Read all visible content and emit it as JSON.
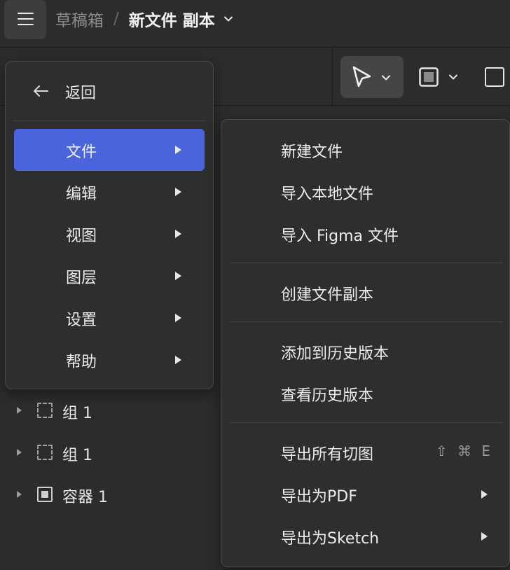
{
  "header": {
    "menu_icon": "hamburger-icon",
    "breadcrumb_parent": "草稿箱",
    "breadcrumb_separator": "/",
    "file_title": "新文件 副本",
    "title_dropdown_icon": "chevron-down-icon"
  },
  "toolbar": {
    "tools": [
      {
        "name": "move-tool",
        "icon": "pointer-icon",
        "has_dropdown": true,
        "active": true
      },
      {
        "name": "frame-tool",
        "icon": "frame-icon",
        "has_dropdown": true
      },
      {
        "name": "rectangle-tool",
        "icon": "rectangle-icon"
      }
    ]
  },
  "main_menu": {
    "back_label": "返回",
    "back_icon": "arrow-left-icon",
    "items": [
      {
        "label": "文件",
        "active": true,
        "has_submenu": true
      },
      {
        "label": "编辑",
        "has_submenu": true
      },
      {
        "label": "视图",
        "has_submenu": true
      },
      {
        "label": "图层",
        "has_submenu": true
      },
      {
        "label": "设置",
        "has_submenu": true
      },
      {
        "label": "帮助",
        "has_submenu": true
      }
    ]
  },
  "file_submenu": {
    "groups": [
      [
        {
          "label": "新建文件"
        },
        {
          "label": "导入本地文件"
        },
        {
          "label": "导入 Figma 文件"
        }
      ],
      [
        {
          "label": "创建文件副本"
        }
      ],
      [
        {
          "label": "添加到历史版本"
        },
        {
          "label": "查看历史版本"
        }
      ],
      [
        {
          "label": "导出所有切图",
          "shortcut": "⇧ ⌘ E"
        },
        {
          "label": "导出为PDF",
          "has_submenu": true
        },
        {
          "label": "导出为Sketch",
          "has_submenu": true
        }
      ]
    ]
  },
  "layers": [
    {
      "label": "组 1",
      "icon": "group-icon"
    },
    {
      "label": "组 1",
      "icon": "group-icon"
    },
    {
      "label": "容器 1",
      "icon": "frame-icon"
    }
  ],
  "colors": {
    "accent": "#4a64dc",
    "background": "#2c2c2c",
    "menu_background": "#2e2e2e"
  }
}
